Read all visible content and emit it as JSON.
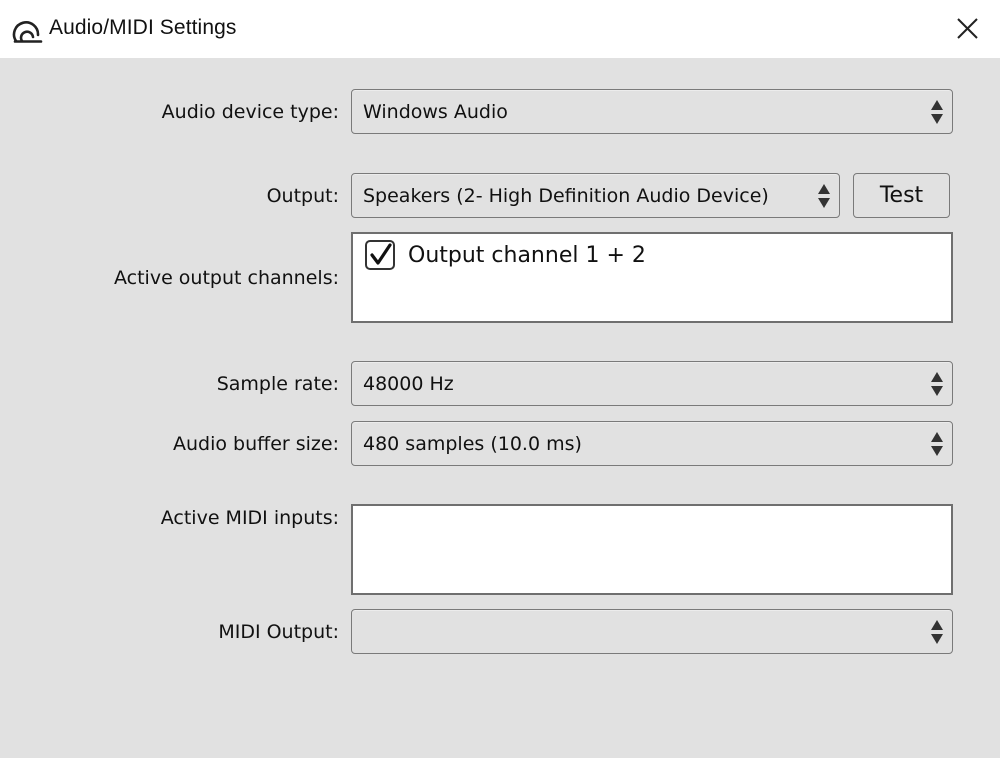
{
  "window": {
    "title": "Audio/MIDI Settings",
    "icon": "app-logo-icon",
    "close_icon": "close-icon"
  },
  "settings": {
    "device_type": {
      "label": "Audio device type:",
      "value": "Windows Audio"
    },
    "output": {
      "label": "Output:",
      "value": "Speakers (2- High Definition Audio Device)",
      "test_label": "Test"
    },
    "active_output_channels": {
      "label": "Active output channels:",
      "items": [
        {
          "label": "Output channel 1 + 2",
          "checked": true
        }
      ]
    },
    "sample_rate": {
      "label": "Sample rate:",
      "value": "48000 Hz"
    },
    "buffer_size": {
      "label": "Audio buffer size:",
      "value": "480 samples (10.0 ms)"
    },
    "midi_inputs": {
      "label": "Active MIDI inputs:",
      "items": []
    },
    "midi_output": {
      "label": "MIDI Output:",
      "value": ""
    }
  },
  "colors": {
    "background": "#e1e1e1",
    "titlebar": "#ffffff",
    "border": "#7a7a7a",
    "listbox": "#ffffff"
  }
}
